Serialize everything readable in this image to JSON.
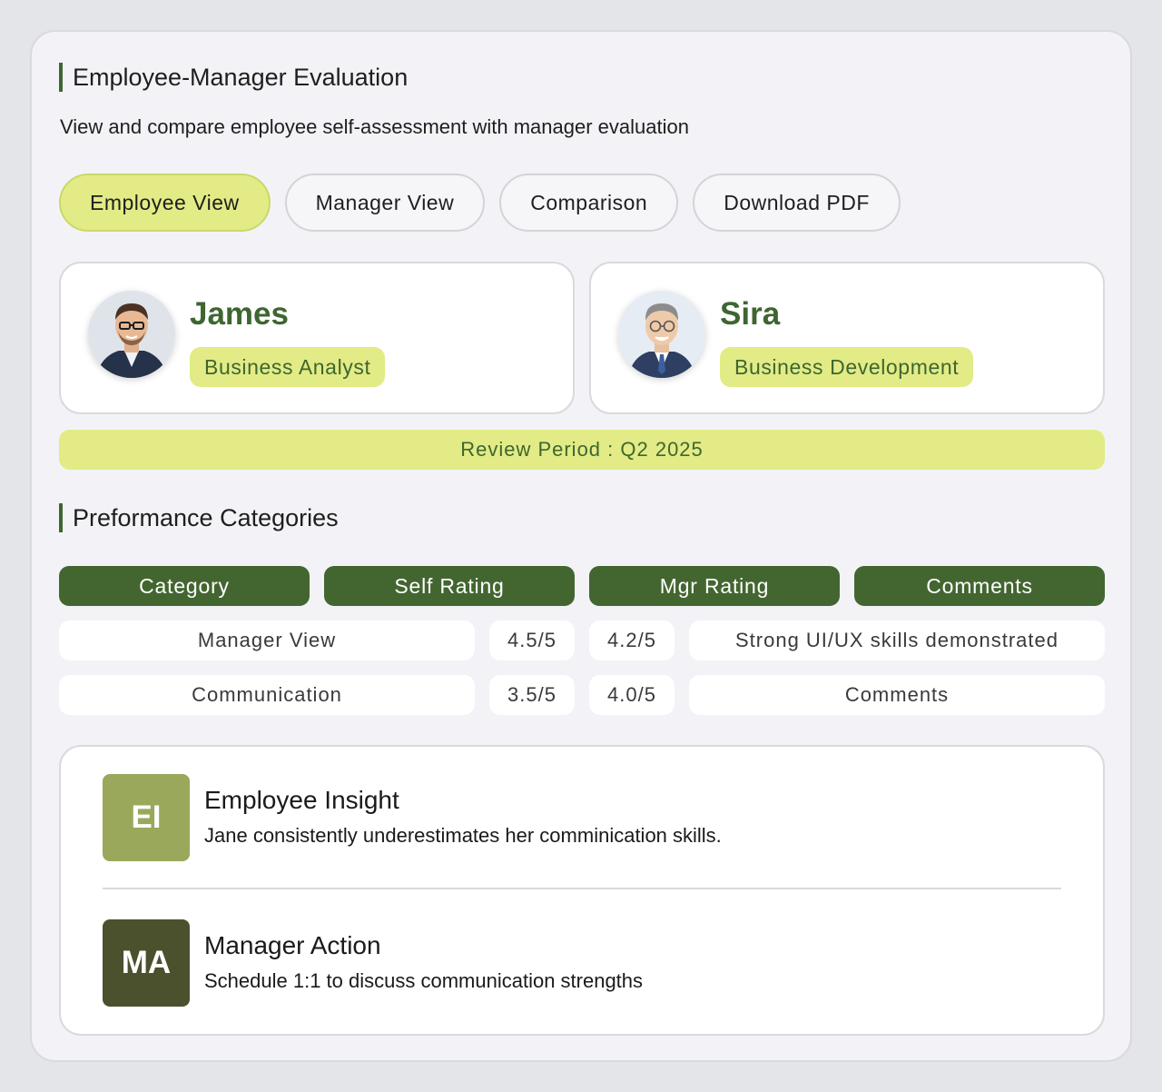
{
  "header": {
    "title": "Employee-Manager Evaluation",
    "subtitle": "View and compare employee self-assessment with manager evaluation"
  },
  "tabs": [
    {
      "label": "Employee View",
      "active": true
    },
    {
      "label": "Manager View",
      "active": false
    },
    {
      "label": "Comparison",
      "active": false
    },
    {
      "label": "Download PDF",
      "active": false
    }
  ],
  "people": [
    {
      "name": "James",
      "role": "Business Analyst"
    },
    {
      "name": "Sira",
      "role": "Business Development"
    }
  ],
  "review_period": "Review Period : Q2 2025",
  "performance": {
    "title": "Preformance Categories",
    "columns": [
      "Category",
      "Self Rating",
      "Mgr Rating",
      "Comments"
    ],
    "rows": [
      {
        "category": "Manager View",
        "self": "4.5/5",
        "mgr": "4.2/5",
        "comment": "Strong UI/UX skills demonstrated"
      },
      {
        "category": "Communication",
        "self": "3.5/5",
        "mgr": "4.0/5",
        "comment": "Comments"
      }
    ]
  },
  "insights": [
    {
      "badge": "EI",
      "title": "Employee Insight",
      "text": "Jane consistently underestimates her comminication skills."
    },
    {
      "badge": "MA",
      "title": "Manager Action",
      "text": "Schedule 1:1 to discuss communication strengths"
    }
  ],
  "colors": {
    "accent_green": "#3e6630",
    "lime": "#e2eb85",
    "header_green": "#436630",
    "ei_badge": "#99a85b",
    "ma_badge": "#4b512d"
  }
}
